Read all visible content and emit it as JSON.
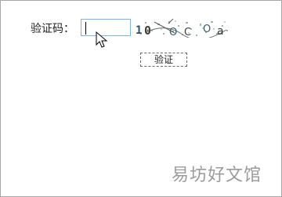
{
  "form": {
    "captcha_label": "验证码：",
    "captcha_input_value": "",
    "captcha_image_text": "10OCOa",
    "submit_label": "验证"
  },
  "watermark": "易坊好文馆"
}
